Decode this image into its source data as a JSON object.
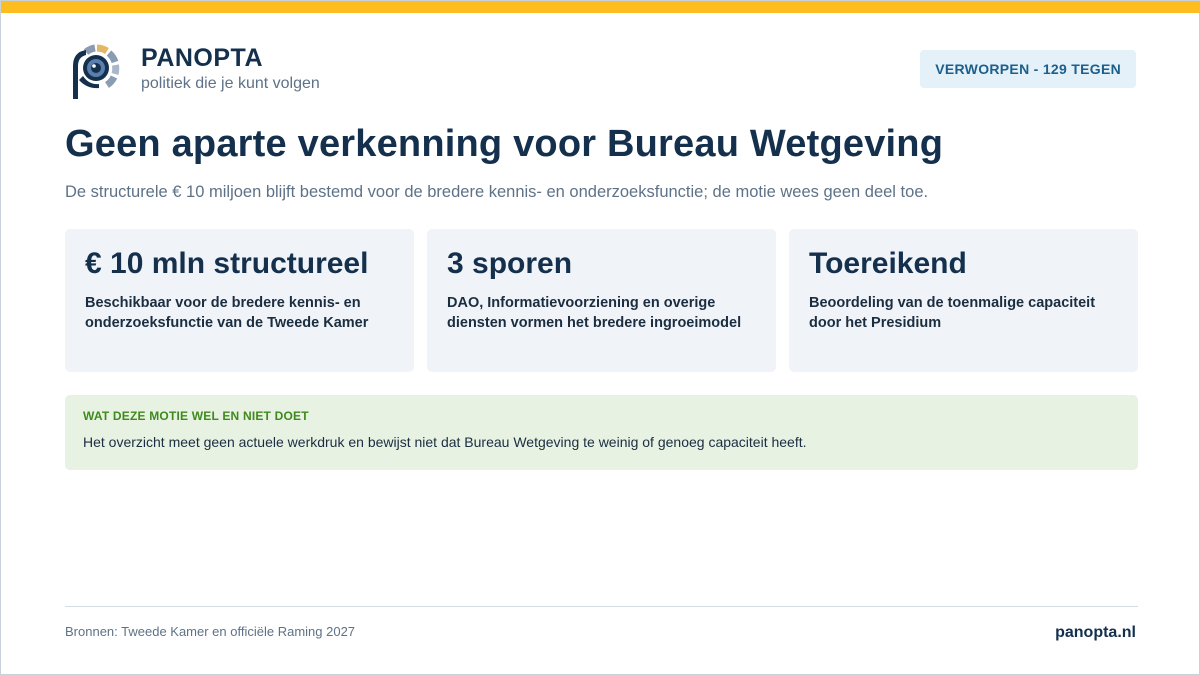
{
  "brand": {
    "name": "PANOPTA",
    "tagline": "politiek die je kunt volgen",
    "colors": {
      "primary": "#14304d",
      "accent": "#fdbd1f",
      "muted": "#5e7287"
    },
    "logo_icon": "panopta-eye-logo-icon"
  },
  "status": {
    "label": "VERWORPEN - 129 TEGEN"
  },
  "headline": {
    "title": "Geen aparte verkenning voor Bureau Wetgeving",
    "subtitle": "De structurele € 10 miljoen blijft bestemd voor de bredere kennis- en onderzoeksfunctie; de motie wees geen deel toe."
  },
  "cards": [
    {
      "value": "€ 10 mln structureel",
      "description": "Beschikbaar voor de bredere kennis- en onderzoeksfunctie van de Tweede Kamer"
    },
    {
      "value": "3 sporen",
      "description": "DAO, Informatievoorziening en overige diensten vormen het bredere ingroeimodel"
    },
    {
      "value": "Toereikend",
      "description": "Beoordeling van de toenmalige capaciteit door het Presidium"
    }
  ],
  "note": {
    "heading": "WAT DEZE MOTIE WEL EN NIET DOET",
    "text": "Het overzicht meet geen actuele werkdruk en bewijst niet dat Bureau Wetgeving te weinig of genoeg capaciteit heeft."
  },
  "footer": {
    "sources": "Bronnen: Tweede Kamer en officiële Raming 2027",
    "site": "panopta.nl"
  }
}
